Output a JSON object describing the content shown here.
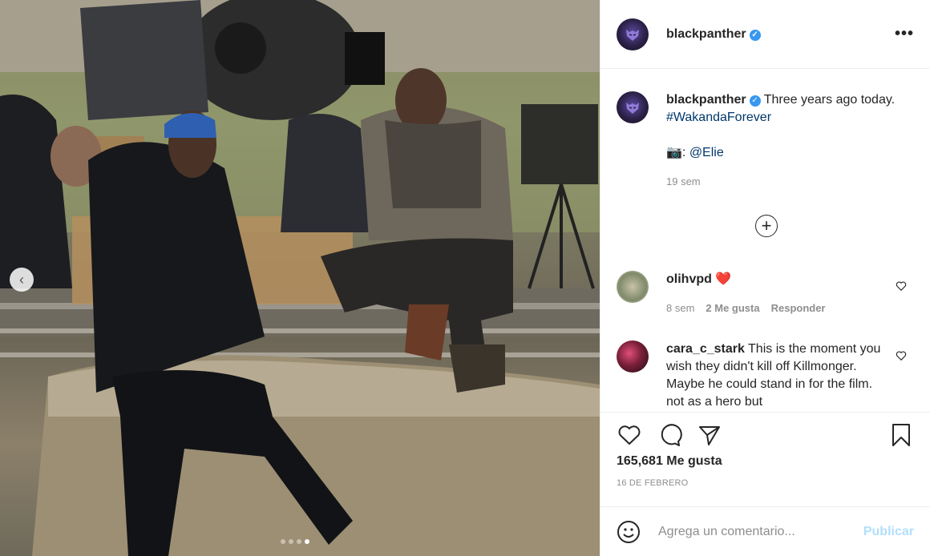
{
  "header": {
    "username": "blackpanther",
    "verified": true,
    "more_label": "•••"
  },
  "caption": {
    "username": "blackpanther",
    "text": "Three years ago today.",
    "hashtag": "#WakandaForever",
    "credit_prefix": "📷: ",
    "credit_mention": "@Elie",
    "age": "19 sem"
  },
  "comments": [
    {
      "username": "olihvpd",
      "text": "❤️",
      "age": "8 sem",
      "likes": "2 Me gusta",
      "reply": "Responder"
    },
    {
      "username": "cara_c_stark",
      "text": "This is the moment you wish they didn't kill off Killmonger. Maybe he could stand in for the film. not as a hero but"
    }
  ],
  "stats": {
    "likes": "165,681 Me gusta",
    "date": "16 DE FEBRERO"
  },
  "add_comment": {
    "placeholder": "Agrega un comentario...",
    "publish": "Publicar"
  },
  "carousel": {
    "count": 4,
    "active": 3
  },
  "colors": {
    "link": "#00376b",
    "verified": "#3897f0",
    "publish_disabled": "#b2dffc",
    "heart": "#ed4956"
  }
}
